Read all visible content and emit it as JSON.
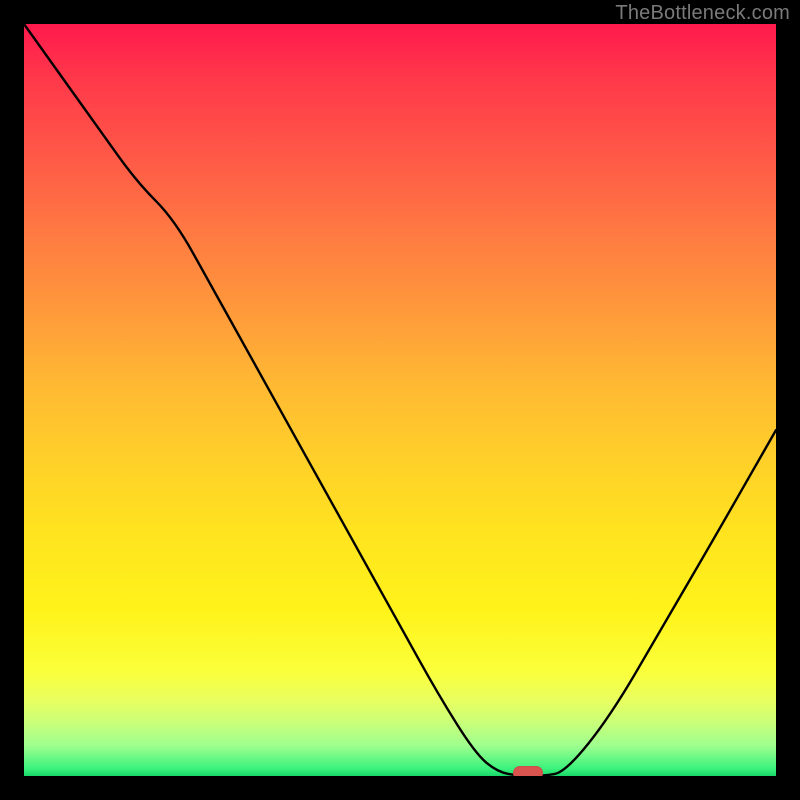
{
  "watermark": "TheBottleneck.com",
  "colors": {
    "frame": "#000000",
    "curve": "#000000",
    "marker": "#d9534f"
  },
  "chart_data": {
    "type": "line",
    "x": [
      0.0,
      0.05,
      0.1,
      0.15,
      0.2,
      0.25,
      0.3,
      0.35,
      0.4,
      0.45,
      0.5,
      0.55,
      0.6,
      0.63,
      0.66,
      0.69,
      0.72,
      0.78,
      0.85,
      0.92,
      1.0
    ],
    "values": [
      100,
      93,
      86,
      79,
      74,
      65,
      56,
      47,
      38,
      29,
      20,
      11,
      3,
      0.5,
      0,
      0,
      0.5,
      8,
      20,
      32,
      46
    ],
    "title": "",
    "xlabel": "",
    "ylabel": "",
    "xlim": [
      0,
      1
    ],
    "ylim": [
      0,
      100
    ],
    "grid": false,
    "marker": {
      "x": 0.67,
      "y": 0
    }
  }
}
